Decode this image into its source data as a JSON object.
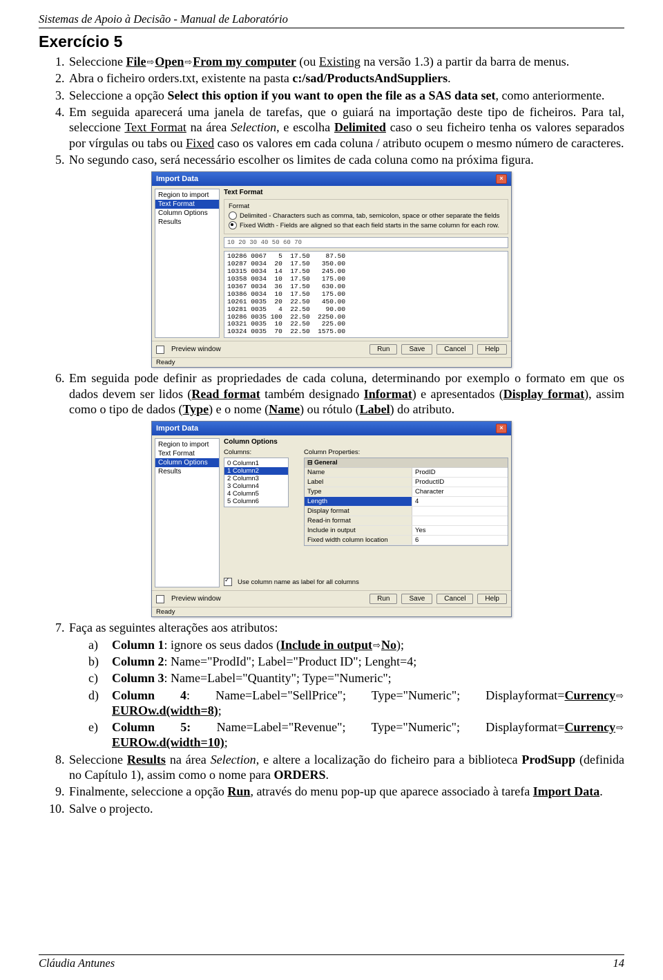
{
  "header": {
    "running": "Sistemas de Apoio à Decisão - Manual de Laboratório"
  },
  "title": "Exercício 5",
  "steps": {
    "s1_a": "Seleccione ",
    "s1_b": "File",
    "s1_c": "Open",
    "s1_d": "From my computer",
    "s1_e": " (ou ",
    "s1_f": "Existing",
    "s1_g": " na versão 1.3) a partir da barra de menus.",
    "s2_a": "Abra o ficheiro orders.txt, existente na pasta ",
    "s2_b": "c:/sad/ProductsAndSuppliers",
    "s2_c": ".",
    "s3_a": "Seleccione a opção ",
    "s3_b": "Select this option if you want to open the file as a SAS data set",
    "s3_c": ", como anteriormente.",
    "s4_a": "Em seguida aparecerá uma janela de tarefas, que o guiará na importação deste tipo de ficheiros. Para tal, seleccione ",
    "s4_b": "Text Format",
    "s4_c": " na área ",
    "s4_d": "Selection",
    "s4_e": ", e escolha ",
    "s4_f": "Delimited",
    "s4_g": " caso o seu ficheiro tenha os valores separados por vírgulas ou tabs ou ",
    "s4_h": "Fixed",
    "s4_i": " caso os valores em cada coluna / atributo ocupem o mesmo número de caracteres.",
    "s5": "No segundo caso, será necessário escolher os limites de cada coluna como na próxima figura.",
    "s6_a": "Em seguida pode definir as propriedades de cada coluna, determinando por exemplo o formato em que os dados devem ser lidos (",
    "s6_b": "Read format",
    "s6_c": " também designado ",
    "s6_d": "Informat",
    "s6_e": ") e apresentados (",
    "s6_f": "Display format",
    "s6_g": "), assim como o tipo de dados (",
    "s6_h": "Type",
    "s6_i": ") e o nome (",
    "s6_j": "Name",
    "s6_k": ") ou rótulo (",
    "s6_l": "Label",
    "s6_m": ") do atributo.",
    "s7_lead": "Faça as seguintes alterações aos atributos:",
    "s7a_a": "Column 1",
    "s7a_b": ": ignore os seus dados (",
    "s7a_c": "Include in output",
    "s7a_d": "No",
    "s7a_e": ");",
    "s7b_a": "Column 2",
    "s7b_b": ": Name=\"ProdId\"; Label=\"Product ID\"; Lenght=4;",
    "s7c_a": "Column 3",
    "s7c_b": ": Name=Label=\"Quantity\"; Type=\"Numeric\";",
    "s7d_a": "Column 4",
    "s7d_b": ": Name=Label=\"SellPrice\"; Type=\"Numeric\"; Displayformat=",
    "s7d_c": "Currency",
    "s7d_d": "EUROw.d(width=8)",
    "s7d_e": ";",
    "s7e_a": "Column 5:",
    "s7e_b": " Name=Label=\"Revenue\"; Type=\"Numeric\"; Displayformat=",
    "s7e_c": "Currency",
    "s7e_d": "EUROw.d(width=10)",
    "s7e_e": ";",
    "s8_a": "Seleccione ",
    "s8_b": "Results",
    "s8_c": " na área ",
    "s8_d": "Selection",
    "s8_e": ", e altere a localização do ficheiro para a biblioteca ",
    "s8_f": "ProdSupp",
    "s8_g": " (definida no Capítulo 1), assim como o nome para ",
    "s8_h": "ORDERS",
    "s8_i": ".",
    "s9_a": "Finalmente, seleccione a opção ",
    "s9_b": "Run",
    "s9_c": ", através do menu pop-up que aparece associado à tarefa ",
    "s9_d": "Import Data",
    "s9_e": ".",
    "s10": "Salve o projecto."
  },
  "dlg1": {
    "title": "Import Data",
    "side": [
      "Region to import",
      "Text Format",
      "Column Options",
      "Results"
    ],
    "side_sel": 1,
    "panel_title": "Text Format",
    "group_label": "Format",
    "radio1": "Delimited - Characters such as comma, tab, semicolon, space or other separate the fields",
    "radio2": "Fixed Width - Fields are aligned so that each field starts in the same column for each row.",
    "ruler": "        10       20       30       40       50       60       70",
    "rows": [
      "10286 0067   5  17.50    87.50",
      "10287 0034  20  17.50   350.00",
      "10315 0034  14  17.50   245.00",
      "10358 0034  10  17.50   175.00",
      "10367 0034  36  17.50   630.00",
      "10386 0034  10  17.50   175.00",
      "10261 0035  20  22.50   450.00",
      "10281 0035   4  22.50    90.00",
      "10286 0035 100  22.50  2250.00",
      "10321 0035  10  22.50   225.00",
      "10324 0035  70  22.50  1575.00"
    ],
    "preview_chk": "Preview window",
    "btn_run": "Run",
    "btn_save": "Save",
    "btn_cancel": "Cancel",
    "btn_help": "Help",
    "status": "Ready"
  },
  "dlg2": {
    "title": "Import Data",
    "side": [
      "Region to import",
      "Text Format",
      "Column Options",
      "Results"
    ],
    "side_sel": 2,
    "panel_title": "Column Options",
    "cols_label": "Columns:",
    "cols": [
      "0 Column1",
      "1 Column2",
      "2 Column3",
      "3 Column4",
      "4 Column5",
      "5 Column6"
    ],
    "cols_sel": 1,
    "props_label": "Column Properties:",
    "cat": "General",
    "props": [
      {
        "k": "Name",
        "v": "ProdID"
      },
      {
        "k": "Label",
        "v": "ProductID"
      },
      {
        "k": "Type",
        "v": "Character"
      },
      {
        "k": "Length",
        "v": "4",
        "sel": true
      },
      {
        "k": "Display format",
        "v": ""
      },
      {
        "k": "Read-in format",
        "v": ""
      },
      {
        "k": "Include in output",
        "v": "Yes"
      },
      {
        "k": "Fixed width column location",
        "v": "6"
      }
    ],
    "use_label_chk": "Use column name as label for all columns",
    "preview_chk": "Preview window",
    "btn_run": "Run",
    "btn_save": "Save",
    "btn_cancel": "Cancel",
    "btn_help": "Help",
    "status": "Ready"
  },
  "footer": {
    "author": "Cláudia Antunes",
    "page": "14"
  }
}
